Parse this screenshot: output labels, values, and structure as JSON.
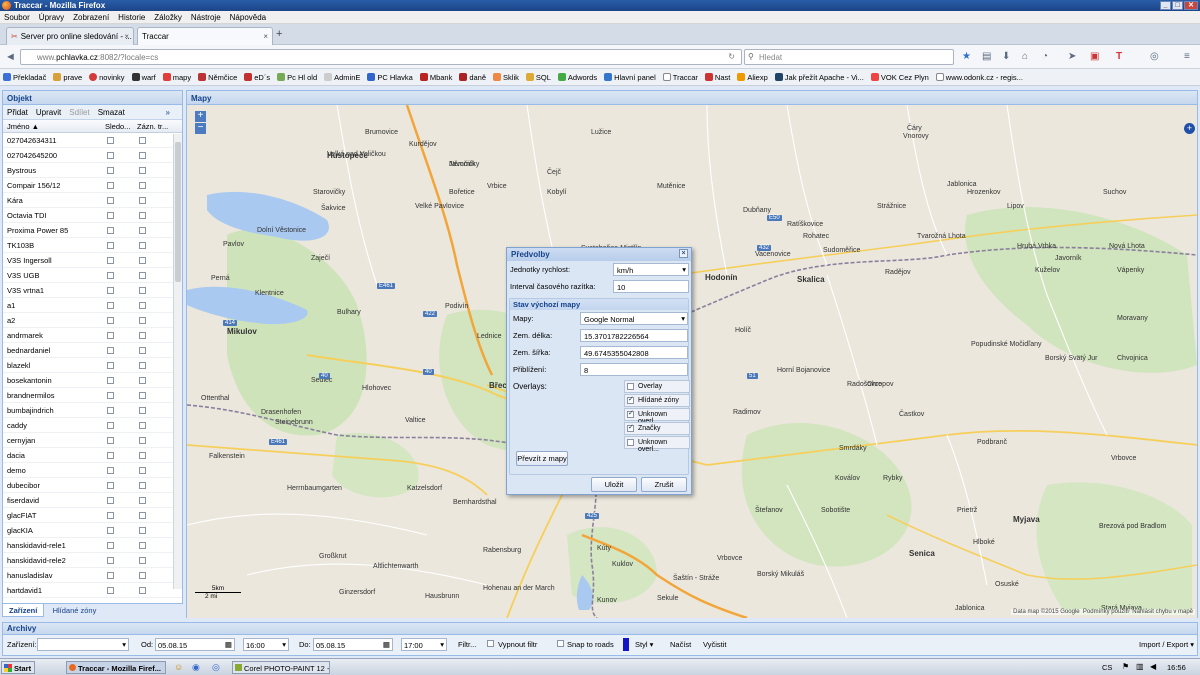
{
  "window": {
    "title": "Traccar - Mozilla Firefox"
  },
  "menu": [
    "Soubor",
    "Úpravy",
    "Zobrazení",
    "Historie",
    "Záložky",
    "Nástroje",
    "Nápověda"
  ],
  "tabs": [
    {
      "label": "Server pro online sledování - ..."
    },
    {
      "label": "Traccar"
    }
  ],
  "address": {
    "prefix": "www.",
    "host": "pchlavka.cz",
    "rest": ":8082/?locale=cs"
  },
  "search": {
    "placeholder": "Hledat"
  },
  "bookmarks": [
    "Překladač",
    "prave",
    "novinky",
    "warf",
    "mapy",
    "Němčice",
    "eD´s",
    "Pc Hl old",
    "AdminE",
    "PC Hlavka",
    "Mbank",
    "daně",
    "Sklik",
    "SQL",
    "Adwords",
    "Hlavní panel",
    "Traccar",
    "Nast",
    "Aliexp",
    "Jak přežít Apache - Vi...",
    "VOK Cez Plyn",
    "www.odonk.cz - regis..."
  ],
  "objects": {
    "title": "Objekt",
    "toolbar": {
      "add": "Přidat",
      "edit": "Upravit",
      "share": "Sdílet",
      "delete": "Smazat"
    },
    "columns": {
      "name": "Jméno ▲",
      "follow": "Sledo...",
      "record": "Zázn. tr..."
    },
    "devices": [
      "027042634311",
      "027042645200",
      "Bystrous",
      "Compair 156/12",
      "Kára",
      "Octavia TDI",
      "Proxima Power 85",
      "TK103B",
      "V3S Ingersoll",
      "V3S UGB",
      "V3S vrtna1",
      "a1",
      "a2",
      "andrmarek",
      "bednardaniel",
      "blazekl",
      "bosekantonin",
      "brandnermilos",
      "bumbajindrich",
      "caddy",
      "cernyjan",
      "dacia",
      "demo",
      "dubecibor",
      "fiserdavid",
      "glacFIAT",
      "glacKIA",
      "hanskidavid-rele1",
      "hanskidavid-rele2",
      "hanusladislav",
      "hartdavid1"
    ],
    "bottom_tabs": [
      "Zařízení",
      "Hlídané zóny"
    ]
  },
  "map": {
    "title": "Mapy",
    "places": [
      {
        "n": "Hustopeče"
      },
      {
        "n": "Němčičky"
      },
      {
        "n": "Bořetice"
      },
      {
        "n": "Velké Pavlovice"
      },
      {
        "n": "Vrbice"
      },
      {
        "n": "Kobylí"
      },
      {
        "n": "Čejč"
      },
      {
        "n": "Mutěnice"
      },
      {
        "n": "Strážnice"
      },
      {
        "n": "Hodonín"
      },
      {
        "n": "Skalica"
      },
      {
        "n": "Holíč"
      },
      {
        "n": "Břeclav"
      },
      {
        "n": "Lednice"
      },
      {
        "n": "Valtice"
      },
      {
        "n": "Mikulov"
      },
      {
        "n": "Pavlov"
      },
      {
        "n": "Perná"
      },
      {
        "n": "Sedlec"
      },
      {
        "n": "Hlohovec"
      },
      {
        "n": "Podivín"
      },
      {
        "n": "Bulhary"
      },
      {
        "n": "Zaječí"
      },
      {
        "n": "Šakvice"
      },
      {
        "n": "Starovičky"
      },
      {
        "n": "Dolní Věstonice"
      },
      {
        "n": "Klentnice"
      },
      {
        "n": "Ottenthal"
      },
      {
        "n": "Drasenhofen"
      },
      {
        "n": "Steinebrunn"
      },
      {
        "n": "Falkenstein"
      },
      {
        "n": "Herrnbaumgarten"
      },
      {
        "n": "Katzelsdorf"
      },
      {
        "n": "Bernhardsthal"
      },
      {
        "n": "Rabensburg"
      },
      {
        "n": "Hohenau an der March"
      },
      {
        "n": "Großkrut"
      },
      {
        "n": "Altlichtenwarth"
      },
      {
        "n": "Ginzersdorf"
      },
      {
        "n": "Hausbrunn"
      },
      {
        "n": "Kúty"
      },
      {
        "n": "Kuklov"
      },
      {
        "n": "Šaštín - Stráže"
      },
      {
        "n": "Borský Mikuláš"
      },
      {
        "n": "Senica"
      },
      {
        "n": "Myjava"
      },
      {
        "n": "Radimov"
      },
      {
        "n": "Kopčany"
      },
      {
        "n": "Radošovce"
      },
      {
        "n": "Chropov"
      },
      {
        "n": "Častkov"
      },
      {
        "n": "Podbranč"
      },
      {
        "n": "Smrdáky"
      },
      {
        "n": "Koválov"
      },
      {
        "n": "Rybky"
      },
      {
        "n": "Štefanov"
      },
      {
        "n": "Sobotište"
      },
      {
        "n": "Prietrž"
      },
      {
        "n": "Vrbovce"
      },
      {
        "n": "Osuské"
      },
      {
        "n": "Hlboké"
      },
      {
        "n": "Jablonica"
      },
      {
        "n": "Brezová pod Bradlom"
      },
      {
        "n": "Vnorovy"
      },
      {
        "n": "Suchov"
      },
      {
        "n": "Hrozenkov"
      },
      {
        "n": "Lipov"
      },
      {
        "n": "Tvarožná Lhota"
      },
      {
        "n": "Hrubá Vrbka"
      },
      {
        "n": "Kuželov"
      },
      {
        "n": "Javorník"
      },
      {
        "n": "Nová Lhota"
      },
      {
        "n": "Vápenky"
      },
      {
        "n": "Radějov"
      },
      {
        "n": "Sudoměřice"
      },
      {
        "n": "Rohatec"
      },
      {
        "n": "Dubňany"
      },
      {
        "n": "Ratíškovice"
      },
      {
        "n": "Vacenovice"
      },
      {
        "n": "Svatobořice-Mistřín"
      },
      {
        "n": "Starý Poddvorov"
      },
      {
        "n": "Lužice"
      },
      {
        "n": "Brumovice"
      },
      {
        "n": "Kurdějov"
      },
      {
        "n": "Horní Bojanovice"
      },
      {
        "n": "Popudinské Močidľany"
      },
      {
        "n": "Chvojnica"
      },
      {
        "n": "Stará Myjava"
      },
      {
        "n": "Vrbovce"
      },
      {
        "n": "Kunov"
      },
      {
        "n": "Sekule"
      },
      {
        "n": "Borský Svätý Jur"
      },
      {
        "n": "Čáry"
      },
      {
        "n": "Jablonica"
      },
      {
        "n": "Moravany"
      },
      {
        "n": "Velká nad Veličkou"
      },
      {
        "n": "Javorník"
      }
    ],
    "attribution": "Data map ©2015 Google",
    "terms": "Podmínky použití",
    "report": "Nahlásit chybu v mapě",
    "scale": {
      "km": "5km",
      "mi": "2 mi"
    }
  },
  "dialog": {
    "title": "Předvolby",
    "speed_label": "Jednotky rychlost:",
    "speed_value": "km/h",
    "interval_label": "Interval časového razítka:",
    "interval_value": "10",
    "section": "Stav výchozí mapy",
    "maps_label": "Mapy:",
    "maps_value": "Google Normal",
    "lon_label": "Zem. délka:",
    "lon_value": "15.3701782226564",
    "lat_label": "Zem. šířka:",
    "lat_value": "49.6745355042808",
    "zoom_label": "Přiblížení:",
    "zoom_value": "8",
    "overlays_label": "Overlays:",
    "overlays": [
      {
        "label": "Overlay",
        "checked": false
      },
      {
        "label": "Hlídané zóny",
        "checked": true
      },
      {
        "label": "Unknown overl...",
        "checked": true
      },
      {
        "label": "Značky",
        "checked": true
      },
      {
        "label": "Unknown overl...",
        "checked": false
      }
    ],
    "take_from_map": "Převzít z mapy",
    "save": "Uložit",
    "cancel": "Zrušit"
  },
  "archive": {
    "title": "Archivy",
    "device_label": "Zařízení:",
    "from_label": "Od:",
    "from_date": "05.08.15",
    "from_time": "16:00",
    "to_label": "Do:",
    "to_date": "05.08.15",
    "to_time": "17:00",
    "filter": "Filtr...",
    "no_filter": "Vypnout filtr",
    "snap": "Snap to roads",
    "style": "Styl",
    "load": "Načíst",
    "clear": "Vyčistit",
    "export": "Import / Export"
  },
  "taskbar": {
    "start": "Start",
    "items": [
      "Traccar - Mozilla Firef...",
      "Corel PHOTO-PAINT 12 -..."
    ],
    "lang": "CS",
    "time": "16:56"
  }
}
